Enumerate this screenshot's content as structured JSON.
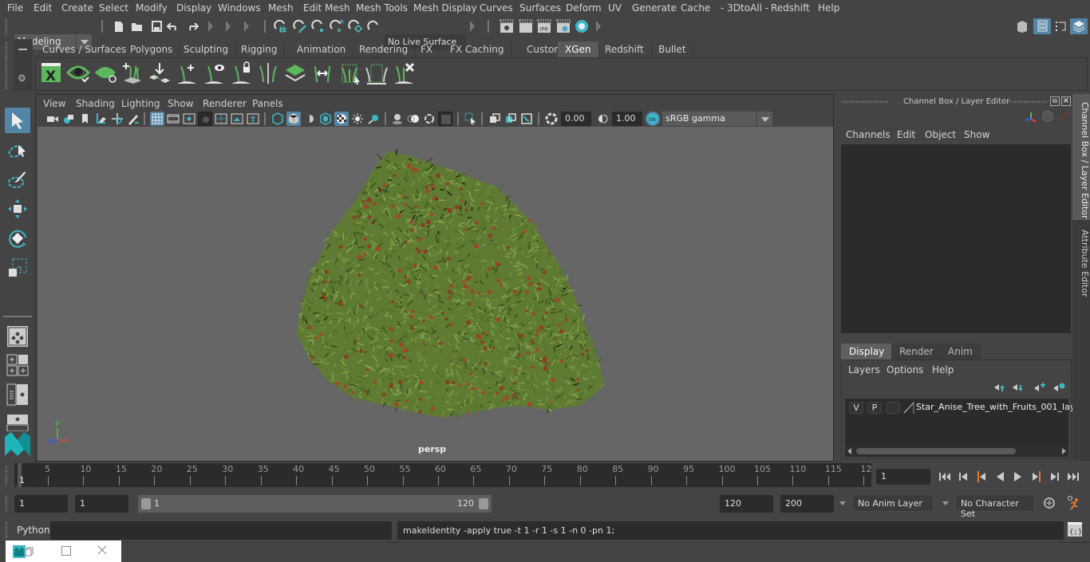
{
  "menubar": {
    "items": [
      "File",
      "Edit",
      "Create",
      "Select",
      "Modify",
      "Display",
      "Windows",
      "Mesh",
      "Edit Mesh",
      "Mesh Tools",
      "Mesh Display",
      "Curves",
      "Surfaces",
      "Deform",
      "UV",
      "Generate",
      "Cache",
      "- 3DtoAll -",
      "Redshift",
      "Help"
    ]
  },
  "statusline": {
    "mode": "Modeling",
    "live_surface": "No Live Surface",
    "icons": [
      "new-scene-icon",
      "open-scene-icon",
      "save-scene-icon",
      "undo-icon",
      "redo-icon",
      "snap-grid-icon",
      "snap-curve-icon",
      "snap-point-icon",
      "snap-view-plane-icon",
      "snap-live-icon",
      "snap-projected-icon",
      "render-view-icon",
      "render-frame-icon",
      "ipr-render-icon",
      "render-settings-icon",
      "hypershade-icon"
    ],
    "right_icons": [
      "modeling-toolkit-icon",
      "attribute-editor-toggle-icon",
      "tool-settings-icon",
      "channel-box-toggle-icon"
    ]
  },
  "shelf": {
    "tabs": [
      "Curves / Surfaces",
      "Polygons",
      "Sculpting",
      "Rigging",
      "Animation",
      "Rendering",
      "FX",
      "FX Caching",
      "Custom",
      "XGen",
      "Redshift",
      "Bullet"
    ],
    "active_tab": "XGen",
    "icons": [
      "xgen-editor-icon",
      "xgen-preview-icon",
      "xgen-clear-preview-icon",
      "xgen-add-guides-icon",
      "xgen-place-guides-icon",
      "xgen-add-guide-icon",
      "xgen-show-guides-icon",
      "xgen-lock-guides-icon",
      "xgen-split-guides-icon",
      "xgen-sculpt-layer-icon",
      "xgen-flip-guides-icon",
      "xgen-select-guides-icon",
      "xgen-guide-tool-icon",
      "xgen-delete-guides-icon"
    ]
  },
  "toolbox": {
    "tools": [
      "select-tool-icon",
      "lasso-select-icon",
      "paint-select-icon",
      "move-tool-icon",
      "rotate-tool-icon",
      "scale-tool-icon"
    ],
    "layouts": [
      "single-pane-layout-icon",
      "four-pane-layout-icon",
      "outliner-layout-icon",
      "persp-graph-layout-icon"
    ]
  },
  "viewport": {
    "menu": [
      "View",
      "Shading",
      "Lighting",
      "Show",
      "Renderer",
      "Panels"
    ],
    "exposure": "0.00",
    "gamma": "1.00",
    "colorspace": "sRGB gamma",
    "camera_label": "persp",
    "axis": {
      "x": "x",
      "y": "y",
      "z": "z"
    }
  },
  "channel_box": {
    "title": "Channel Box / Layer Editor",
    "menu": [
      "Channels",
      "Edit",
      "Object",
      "Show"
    ]
  },
  "layer_editor": {
    "tabs": [
      "Display",
      "Render",
      "Anim"
    ],
    "active_tab": "Display",
    "menu": [
      "Layers",
      "Options",
      "Help"
    ],
    "layers": [
      {
        "visible": "V",
        "playback": "P",
        "name": "Star_Anise_Tree_with_Fruits_001_laye"
      }
    ]
  },
  "side_tabs": [
    "Channel Box / Layer Editor",
    "Attribute Editor"
  ],
  "timeline": {
    "ticks": [
      5,
      10,
      15,
      20,
      25,
      30,
      35,
      40,
      45,
      50,
      55,
      60,
      65,
      70,
      75,
      80,
      85,
      90,
      95,
      100,
      105,
      110,
      115,
      "12"
    ],
    "start_marker": "1",
    "current_frame": "1"
  },
  "range": {
    "start": "1",
    "playback_start": "1",
    "slider_min": "1",
    "slider_max": "120",
    "playback_end": "120",
    "end": "200",
    "anim_layer": "No Anim Layer",
    "character_set": "No Character Set"
  },
  "command": {
    "language": "Python",
    "input": "",
    "result": "makeIdentity -apply true -t 1 -r 1 -s 1 -n 0 -pn 1;"
  }
}
